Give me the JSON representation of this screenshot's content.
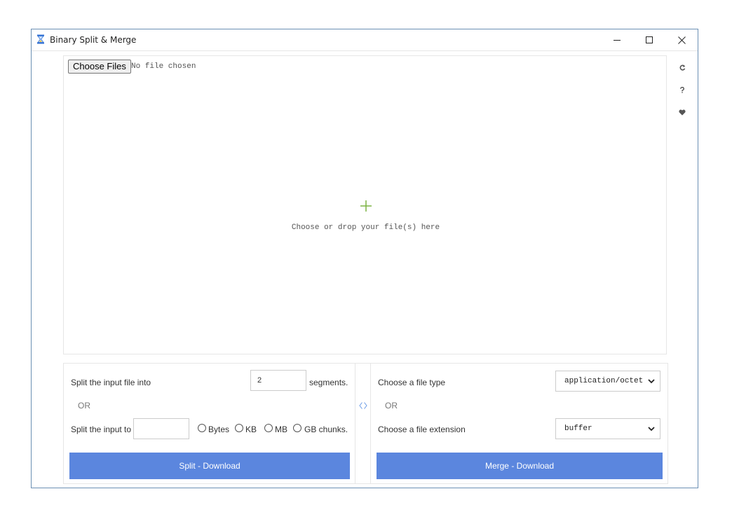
{
  "window": {
    "title": "Binary Split & Merge"
  },
  "file_picker": {
    "button_label": "Choose Files",
    "status": "No file chosen"
  },
  "drop_zone": {
    "hint": "Choose or drop your file(s) here"
  },
  "sidebar": {
    "icons": [
      "refresh-icon",
      "help-icon",
      "heart-icon"
    ]
  },
  "split": {
    "segments_prefix": "Split the input file into",
    "segments_value": "2",
    "segments_suffix": "segments.",
    "or_label": "OR",
    "size_prefix": "Split the input to",
    "size_value": "",
    "units": [
      "Bytes",
      "KB",
      "MB",
      "GB chunks."
    ],
    "button_label": "Split - Download"
  },
  "merge": {
    "file_type_label": "Choose a file type",
    "file_type_value": "application/octet",
    "or_label": "OR",
    "extension_label": "Choose a file extension",
    "extension_value": "buffer",
    "button_label": "Merge - Download"
  },
  "colors": {
    "accent": "#5b86de",
    "plus": "#7cb342",
    "swap_icon": "#6a9be6"
  }
}
